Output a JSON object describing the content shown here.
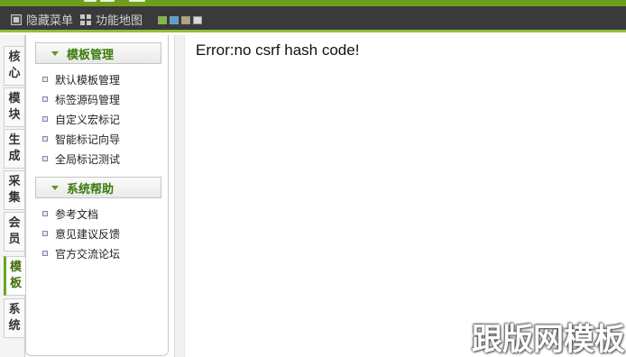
{
  "toolbar": {
    "hide_menu_label": "隐藏菜单",
    "sitemap_label": "功能地图",
    "skin_colors": [
      "#7bbf2a",
      "#4aa3d8",
      "#b6a37a",
      "#d9d9d9"
    ]
  },
  "tabs": [
    {
      "chars": [
        "核",
        "心"
      ]
    },
    {
      "chars": [
        "模",
        "块"
      ]
    },
    {
      "chars": [
        "生",
        "成"
      ]
    },
    {
      "chars": [
        "采",
        "集"
      ]
    },
    {
      "chars": [
        "会",
        "员"
      ]
    },
    {
      "chars": [
        "模",
        "板"
      ],
      "active": true
    },
    {
      "chars": [
        "系",
        "统"
      ]
    }
  ],
  "menu": {
    "sections": [
      {
        "title": "模板管理",
        "items": [
          "默认模板管理",
          "标签源码管理",
          "自定义宏标记",
          "智能标记向导",
          "全局标记测试"
        ]
      },
      {
        "title": "系统帮助",
        "items": [
          "参考文档",
          "意见建议反馈",
          "官方交流论坛"
        ]
      }
    ]
  },
  "main": {
    "message": "Error:no csrf hash code!"
  },
  "watermark": "跟版网模板"
}
